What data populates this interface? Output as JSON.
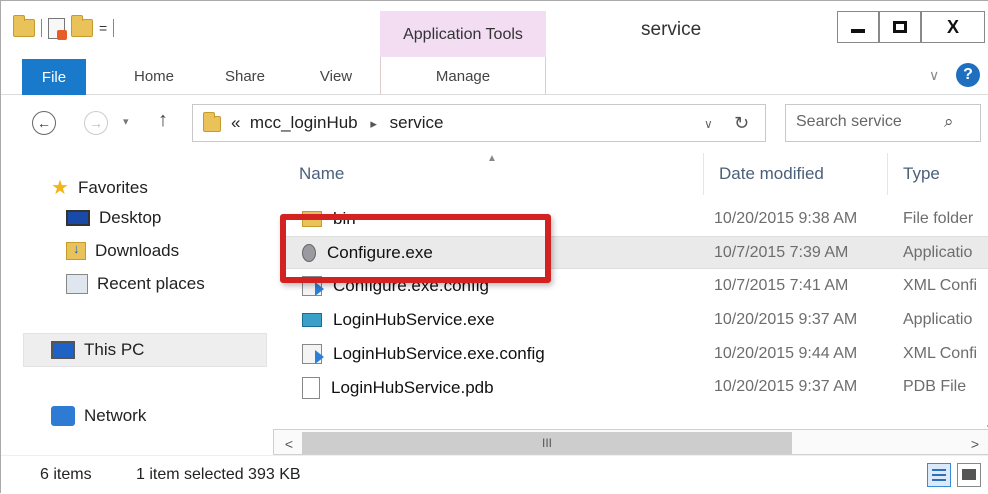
{
  "window": {
    "title": "service",
    "context_tab": "Application Tools",
    "controls": {
      "minimize": "",
      "maximize": "",
      "close": "X"
    }
  },
  "quick_access": {
    "dropdown": "="
  },
  "ribbon": {
    "tabs": [
      "File",
      "Home",
      "Share",
      "View",
      "Manage"
    ],
    "collapse_chevron": "∨",
    "help": "?"
  },
  "address_bar": {
    "prefix": "«",
    "crumbs": [
      "mcc_loginHub",
      "service"
    ],
    "separator": "▸",
    "dropdown": "∨",
    "refresh": "↻"
  },
  "navigation": {
    "back": "←",
    "forward": "→",
    "history": "▾",
    "up": "↑"
  },
  "search": {
    "placeholder": "Search service",
    "icon": "⌕"
  },
  "nav_pane": {
    "favorites": "Favorites",
    "desktop": "Desktop",
    "downloads": "Downloads",
    "recent": "Recent places",
    "this_pc": "This PC",
    "network": "Network"
  },
  "columns": {
    "name": "Name",
    "date": "Date modified",
    "type": "Type"
  },
  "files": [
    {
      "name": "bin",
      "date": "10/20/2015 9:38 AM",
      "type": "File folder",
      "icon": "folder-icon"
    },
    {
      "name": "Configure.exe",
      "date": "10/7/2015 7:39 AM",
      "type": "Applicatio",
      "icon": "exe-icon",
      "selected": true
    },
    {
      "name": "Configure.exe.config",
      "date": "10/7/2015 7:41 AM",
      "type": "XML Confi",
      "icon": "config-file-icon"
    },
    {
      "name": "LoginHubService.exe",
      "date": "10/20/2015 9:37 AM",
      "type": "Applicatio",
      "icon": "service-exe-icon"
    },
    {
      "name": "LoginHubService.exe.config",
      "date": "10/20/2015 9:44 AM",
      "type": "XML Confi",
      "icon": "config-file-icon"
    },
    {
      "name": "LoginHubService.pdb",
      "date": "10/20/2015 9:37 AM",
      "type": "PDB File",
      "icon": "pdb-file-icon"
    }
  ],
  "scrollbar": {
    "left": "<",
    "thumb": "III",
    "right": ">"
  },
  "status": {
    "count": "6 items",
    "selection": "1 item selected  393 KB"
  },
  "colors": {
    "file_tab": "#1979ca",
    "context_tab": "#f2ddf3",
    "highlight_box": "#d32222",
    "header_text": "#4c607a"
  }
}
